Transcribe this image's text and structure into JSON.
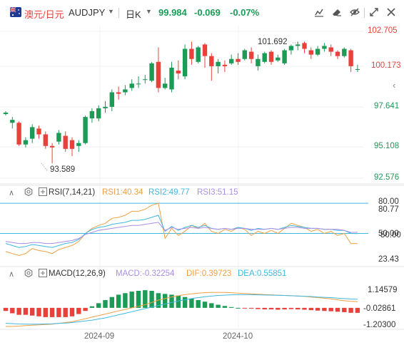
{
  "header": {
    "instrument_name": "澳元/日元",
    "symbol": "AUDJPY",
    "period": "日K",
    "price": "99.984",
    "change": "-0.069",
    "change_pct": "-0.07%",
    "up_color": "#e8413b",
    "down_color": "#1b9b56",
    "icons": [
      "drawing-pen-icon",
      "eraser-icon",
      "eye-off-icon",
      "fullscreen-icon",
      "close-icon"
    ]
  },
  "main_pane": {
    "y_ticks": [
      "102.705",
      "100.173",
      "97.641",
      "95.108",
      "92.576"
    ],
    "high_label": "101.692",
    "low_label": "93.589",
    "collapse_icon": "chevron-left-icon"
  },
  "rsi_pane": {
    "title": "RSI(7,14,21)",
    "rsi1": "RSI1:40.34",
    "rsi2": "RSI2:49.77",
    "rsi3": "RSI3:51.15",
    "y_ticks": [
      "80.00",
      "80.77",
      "50.00",
      "50.00",
      "23.43"
    ],
    "colors": {
      "rsi1": "#f0a043",
      "rsi2": "#3fb8e0",
      "rsi3": "#a98ee6"
    }
  },
  "macd_pane": {
    "title": "MACD(12,26,9)",
    "macd": "MACD:-0.32254",
    "dif": "DIF:0.39723",
    "dea": "DEA:0.55851",
    "y_ticks": [
      "1.14579",
      "-0.02861",
      "-1.20300"
    ],
    "colors": {
      "macd": "#a98ee6",
      "dif": "#f0a043",
      "dea": "#3fb8e0"
    }
  },
  "x_axis": [
    "2024-09",
    "2024-10"
  ],
  "chart_data": [
    {
      "type": "candlestick",
      "title": "",
      "ylim": [
        92.576,
        102.705
      ],
      "candles": [
        [
          97.0,
          97.1,
          97.2,
          96.9
        ],
        [
          96.4,
          96.6,
          96.8,
          96.0
        ],
        [
          96.4,
          94.9,
          96.5,
          94.8
        ],
        [
          94.9,
          95.2,
          95.4,
          94.7
        ],
        [
          95.3,
          96.1,
          96.3,
          95.0
        ],
        [
          96.0,
          95.6,
          96.2,
          95.3
        ],
        [
          95.6,
          94.8,
          95.8,
          94.6
        ],
        [
          94.8,
          94.7,
          95.0,
          93.6
        ],
        [
          95.1,
          95.7,
          95.9,
          94.9
        ],
        [
          95.5,
          94.6,
          95.8,
          94.4
        ],
        [
          95.2,
          94.6,
          95.4,
          94.1
        ],
        [
          94.8,
          95.0,
          95.2,
          94.4
        ],
        [
          95.0,
          96.8,
          96.9,
          94.9
        ],
        [
          96.7,
          97.2,
          97.4,
          96.4
        ],
        [
          96.7,
          97.4,
          97.6,
          96.5
        ],
        [
          97.4,
          97.5,
          97.9,
          97.1
        ],
        [
          97.5,
          98.5,
          98.7,
          97.2
        ],
        [
          98.5,
          98.4,
          98.9,
          98.0
        ],
        [
          98.5,
          98.7,
          99.0,
          98.3
        ],
        [
          98.8,
          99.1,
          99.4,
          98.6
        ],
        [
          99.1,
          99.1,
          99.6,
          98.8
        ],
        [
          99.4,
          99.4,
          99.7,
          99.1
        ],
        [
          99.3,
          100.5,
          100.6,
          99.2
        ],
        [
          100.6,
          98.8,
          101.6,
          98.5
        ],
        [
          98.8,
          99.1,
          99.5,
          98.7
        ],
        [
          98.7,
          100.2,
          100.6,
          98.5
        ],
        [
          100.0,
          99.8,
          100.7,
          99.4
        ],
        [
          99.6,
          101.5,
          101.8,
          99.4
        ],
        [
          101.5,
          100.8,
          102.0,
          100.4
        ],
        [
          100.6,
          101.6,
          101.7,
          100.5
        ],
        [
          101.8,
          101.0,
          101.9,
          100.2
        ],
        [
          101.0,
          100.3,
          101.2,
          99.3
        ],
        [
          100.3,
          100.6,
          100.8,
          99.8
        ],
        [
          100.4,
          100.3,
          100.7,
          99.9
        ],
        [
          100.5,
          100.8,
          101.1,
          100.4
        ],
        [
          100.8,
          100.6,
          101.2,
          100.4
        ],
        [
          100.8,
          101.4,
          101.5,
          100.7
        ],
        [
          101.3,
          100.8,
          101.6,
          100.5
        ],
        [
          100.3,
          100.8,
          101.1,
          100.0
        ],
        [
          100.6,
          101.2,
          101.3,
          100.5
        ],
        [
          101.3,
          100.6,
          101.4,
          100.4
        ],
        [
          100.7,
          100.9,
          101.1,
          100.6
        ],
        [
          100.5,
          101.4,
          101.5,
          100.4
        ],
        [
          101.4,
          101.7,
          101.8,
          101.1
        ],
        [
          101.7,
          101.8,
          102.0,
          101.4
        ],
        [
          101.9,
          101.5,
          102.0,
          101.2
        ],
        [
          101.4,
          101.1,
          101.6,
          100.8
        ],
        [
          101.1,
          101.5,
          101.7,
          101.0
        ],
        [
          101.5,
          101.7,
          101.9,
          101.3
        ],
        [
          101.6,
          101.3,
          101.8,
          101.0
        ],
        [
          101.3,
          101.0,
          101.4,
          100.8
        ],
        [
          101.0,
          101.5,
          101.6,
          100.9
        ],
        [
          101.4,
          100.3,
          101.5,
          99.9
        ],
        [
          100.1,
          100.1,
          100.4,
          99.9
        ]
      ],
      "markers": {
        "high": 101.692,
        "low": 93.589
      }
    },
    {
      "type": "line",
      "title": "RSI(7,14,21)",
      "ylim": [
        23.43,
        80.77
      ],
      "series": [
        {
          "name": "RSI1",
          "values": [
            32,
            30,
            28,
            30,
            35,
            33,
            32,
            30,
            34,
            36,
            38,
            42,
            50,
            55,
            58,
            60,
            65,
            66,
            68,
            72,
            72,
            74,
            78,
            80,
            45,
            55,
            48,
            52,
            58,
            55,
            60,
            52,
            50,
            54,
            52,
            56,
            54,
            48,
            52,
            50,
            53,
            50,
            55,
            60,
            58,
            56,
            52,
            54,
            50,
            52,
            48,
            50,
            40,
            40
          ]
        },
        {
          "name": "RSI2",
          "values": [
            40,
            38,
            36,
            37,
            39,
            38,
            37,
            36,
            38,
            40,
            41,
            44,
            50,
            54,
            56,
            57,
            59,
            60,
            61,
            63,
            63,
            64,
            66,
            68,
            52,
            57,
            53,
            56,
            58,
            56,
            58,
            55,
            54,
            55,
            54,
            56,
            55,
            53,
            55,
            54,
            55,
            54,
            56,
            58,
            57,
            56,
            55,
            55,
            54,
            54,
            53,
            53,
            50,
            49.77
          ]
        },
        {
          "name": "RSI3",
          "values": [
            42,
            41,
            40,
            40,
            41,
            41,
            40,
            40,
            41,
            42,
            43,
            45,
            49,
            51,
            53,
            54,
            55,
            56,
            57,
            58,
            58,
            59,
            60,
            61,
            53,
            56,
            54,
            55,
            56,
            55,
            56,
            55,
            54,
            55,
            54,
            55,
            55,
            54,
            54,
            54,
            55,
            54,
            55,
            56,
            56,
            55,
            55,
            55,
            54,
            54,
            54,
            53,
            51,
            51.15
          ]
        }
      ]
    },
    {
      "type": "bar",
      "title": "MACD(12,26,9)",
      "ylim": [
        -1.203,
        1.14579
      ],
      "series": [
        {
          "name": "MACD",
          "values": [
            -0.2,
            -0.35,
            -0.45,
            -0.45,
            -0.5,
            -0.55,
            -0.6,
            -0.6,
            -0.6,
            -0.6,
            -0.55,
            -0.4,
            -0.2,
            0.1,
            0.3,
            0.5,
            0.7,
            0.85,
            0.95,
            1.05,
            1.1,
            1.14,
            1.1,
            0.95,
            0.9,
            0.85,
            0.8,
            0.7,
            0.6,
            0.5,
            0.4,
            0.3,
            0.2,
            0.12,
            0.05,
            0.0,
            -0.03,
            -0.05,
            -0.08,
            -0.1,
            -0.1,
            -0.12,
            -0.1,
            -0.08,
            -0.1,
            -0.12,
            -0.15,
            -0.18,
            -0.2,
            -0.22,
            -0.25,
            -0.28,
            -0.32,
            -0.32254
          ]
        },
        {
          "name": "DIF",
          "values": [
            -1.2,
            -1.2,
            -1.18,
            -1.15,
            -1.12,
            -1.1,
            -1.08,
            -1.05,
            -1.0,
            -0.95,
            -0.9,
            -0.8,
            -0.7,
            -0.6,
            -0.5,
            -0.4,
            -0.3,
            -0.2,
            -0.1,
            0.0,
            0.1,
            0.2,
            0.35,
            0.5,
            0.6,
            0.7,
            0.78,
            0.85,
            0.9,
            0.95,
            0.98,
            1.0,
            1.0,
            1.0,
            0.98,
            0.95,
            0.93,
            0.9,
            0.88,
            0.86,
            0.84,
            0.82,
            0.8,
            0.78,
            0.76,
            0.74,
            0.7,
            0.66,
            0.62,
            0.58,
            0.52,
            0.46,
            0.42,
            0.39723
          ]
        },
        {
          "name": "DEA",
          "values": [
            -1.0,
            -1.02,
            -1.04,
            -1.05,
            -1.05,
            -1.05,
            -1.04,
            -1.03,
            -1.0,
            -0.98,
            -0.95,
            -0.9,
            -0.85,
            -0.8,
            -0.72,
            -0.65,
            -0.55,
            -0.45,
            -0.35,
            -0.25,
            -0.15,
            -0.05,
            0.05,
            0.15,
            0.25,
            0.35,
            0.45,
            0.52,
            0.6,
            0.66,
            0.72,
            0.76,
            0.8,
            0.82,
            0.84,
            0.85,
            0.85,
            0.85,
            0.84,
            0.83,
            0.82,
            0.81,
            0.8,
            0.78,
            0.77,
            0.75,
            0.73,
            0.7,
            0.68,
            0.66,
            0.63,
            0.6,
            0.57,
            0.55851
          ]
        }
      ]
    }
  ]
}
